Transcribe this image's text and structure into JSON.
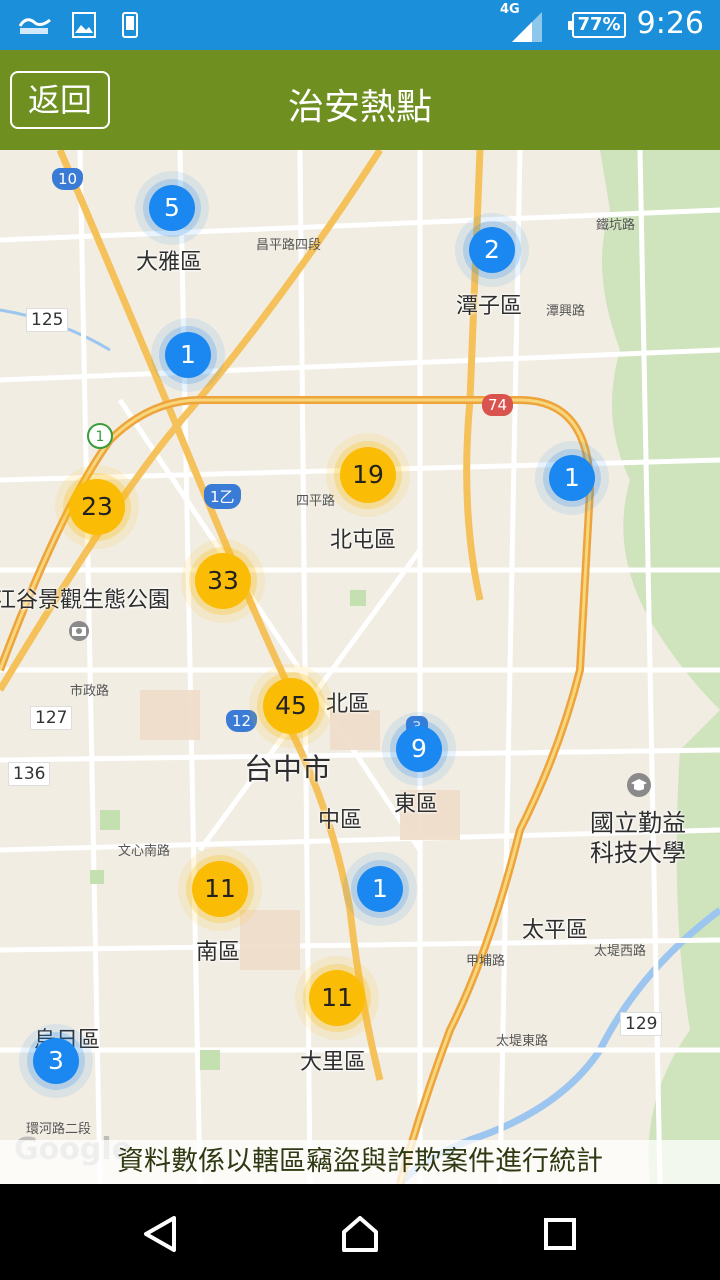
{
  "status_bar": {
    "network": "4G",
    "battery": "77%",
    "time": "9:26",
    "icons": [
      "pulse-app-icon",
      "image-icon",
      "phone-icon",
      "signal-icon",
      "battery-icon"
    ]
  },
  "header": {
    "back_label": "返回",
    "title": "治安熱點"
  },
  "map": {
    "places": [
      {
        "id": "dayan",
        "label": "大雅區"
      },
      {
        "id": "tanzi",
        "label": "潭子區"
      },
      {
        "id": "beitun",
        "label": "北屯區"
      },
      {
        "id": "park",
        "label": "江谷景觀生態公園"
      },
      {
        "id": "north",
        "label": "北區"
      },
      {
        "id": "taichung",
        "label": "台中市"
      },
      {
        "id": "central",
        "label": "中區"
      },
      {
        "id": "east",
        "label": "東區"
      },
      {
        "id": "univ",
        "label": "國立勤益\n科技大學"
      },
      {
        "id": "taiping",
        "label": "太平區"
      },
      {
        "id": "south",
        "label": "南區"
      },
      {
        "id": "dali",
        "label": "大里區"
      },
      {
        "id": "wuri",
        "label": "烏日區"
      }
    ],
    "roads": {
      "r10": "10",
      "r125": "125",
      "r74": "74",
      "r1y": "1乙",
      "r127": "127",
      "r136": "136",
      "r12": "12",
      "r129": "129",
      "r3": "3",
      "t_chunping4": "昌平路四段",
      "t_sichung": "四平路",
      "t_shijheng": "市政路",
      "t_wenxin": "文心南路",
      "t_jiapu": "甲埔路",
      "t_taiti": "太堤西路",
      "t_taiti_e": "太堤東路",
      "t_huanhe": "環河路二段",
      "t_tanhsing": "潭興路",
      "t_zhongxing": "鐵坑路"
    },
    "clusters": [
      {
        "id": "c-dayan",
        "count": "5",
        "color": "blue"
      },
      {
        "id": "c-tanzi",
        "count": "2",
        "color": "blue"
      },
      {
        "id": "c-west",
        "count": "1",
        "color": "blue"
      },
      {
        "id": "c-beitun",
        "count": "19",
        "color": "gold"
      },
      {
        "id": "c-east1",
        "count": "1",
        "color": "blue"
      },
      {
        "id": "c-23",
        "count": "23",
        "color": "gold"
      },
      {
        "id": "c-33",
        "count": "33",
        "color": "gold"
      },
      {
        "id": "c-45",
        "count": "45",
        "color": "gold"
      },
      {
        "id": "c-eastdist",
        "count": "9",
        "color": "blue"
      },
      {
        "id": "c-south",
        "count": "11",
        "color": "gold"
      },
      {
        "id": "c-central1",
        "count": "1",
        "color": "blue"
      },
      {
        "id": "c-dali",
        "count": "11",
        "color": "gold"
      },
      {
        "id": "c-wuri",
        "count": "3",
        "color": "blue"
      }
    ],
    "attribution": "Google",
    "footer_note": "資料數係以轄區竊盜與詐欺案件進行統計"
  },
  "colors": {
    "status_bar": "#1b8fd9",
    "title_bar": "#6f8f21",
    "cluster_blue": "#1a88f0",
    "cluster_gold": "#fbbc05"
  },
  "nav": {
    "icons": [
      "back-triangle-icon",
      "home-icon",
      "recent-apps-icon"
    ]
  }
}
